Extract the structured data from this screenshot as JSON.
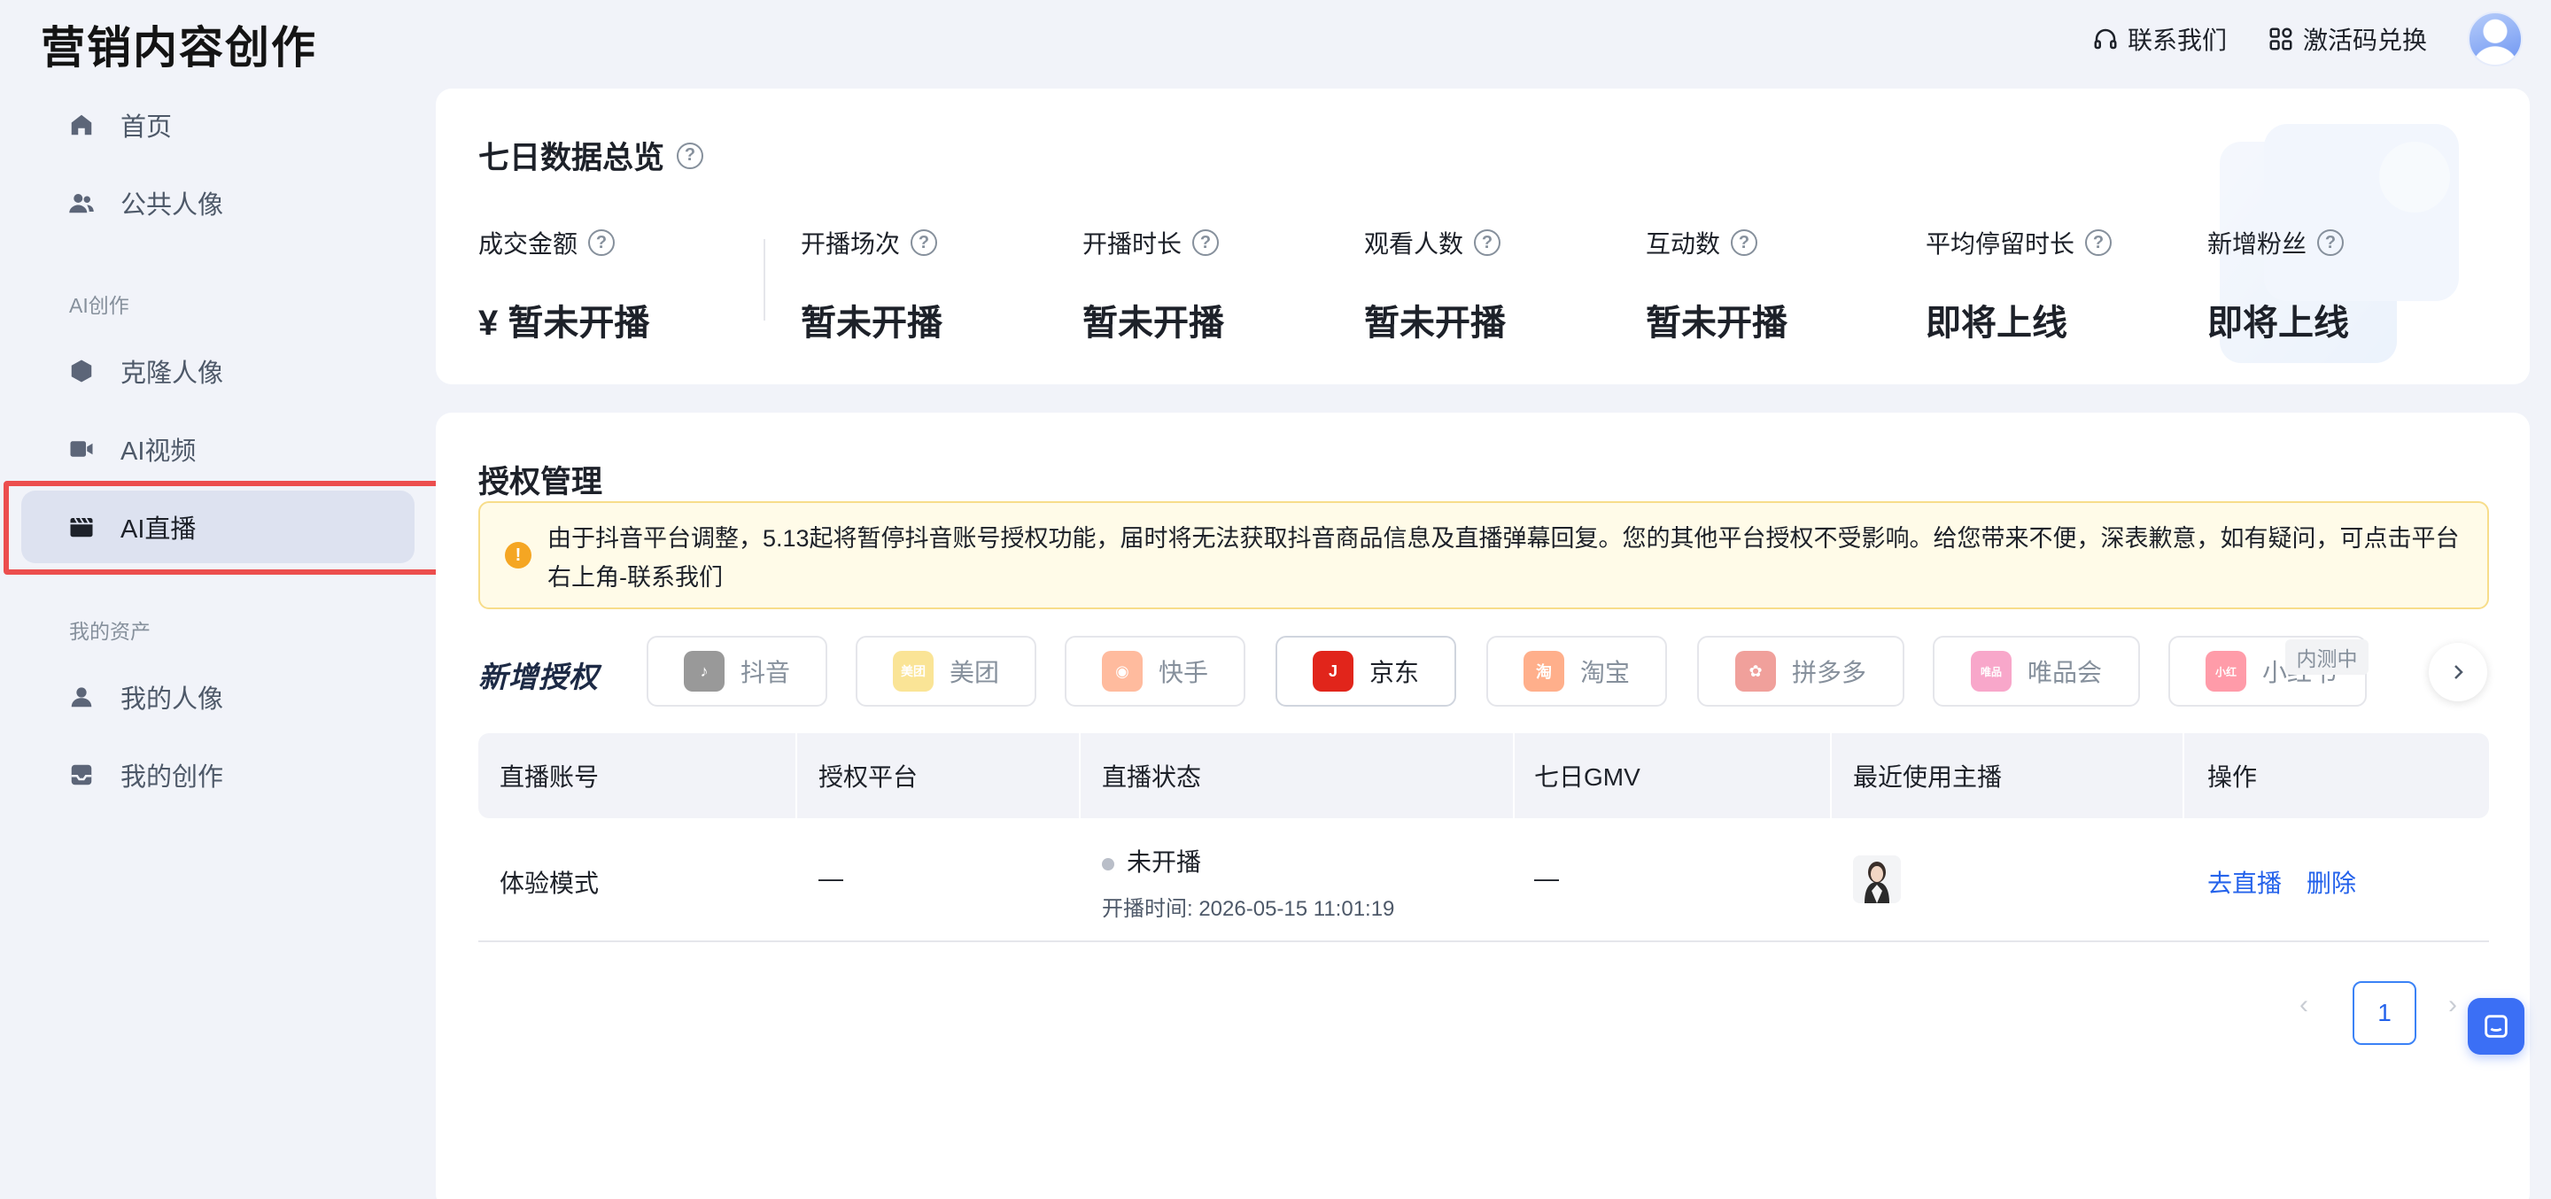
{
  "app": {
    "logo": "营销内容创作"
  },
  "header": {
    "contact": "联系我们",
    "redeem": "激活码兑换"
  },
  "sidebar": {
    "items": [
      {
        "label": "首页",
        "icon": "home-icon"
      },
      {
        "label": "公共人像",
        "icon": "users-icon"
      },
      {
        "label": "克隆人像",
        "icon": "hexagon-icon"
      },
      {
        "label": "AI视频",
        "icon": "video-camera-icon"
      },
      {
        "label": "AI直播",
        "icon": "clapperboard-icon",
        "active": true
      },
      {
        "label": "我的人像",
        "icon": "user-icon"
      },
      {
        "label": "我的创作",
        "icon": "inbox-icon"
      }
    ],
    "groups": {
      "ai_create": "AI创作",
      "my_assets": "我的资产"
    }
  },
  "stats": {
    "title": "七日数据总览",
    "items": [
      {
        "label": "成交金额",
        "value": "¥ 暂未开播"
      },
      {
        "label": "开播场次",
        "value": "暂未开播"
      },
      {
        "label": "开播时长",
        "value": "暂未开播"
      },
      {
        "label": "观看人数",
        "value": "暂未开播"
      },
      {
        "label": "互动数",
        "value": "暂未开播"
      },
      {
        "label": "平均停留时长",
        "value": "即将上线"
      },
      {
        "label": "新增粉丝",
        "value": "即将上线"
      }
    ]
  },
  "auth": {
    "title": "授权管理",
    "notice": "由于抖音平台调整，5.13起将暂停抖音账号授权功能，届时将无法获取抖音商品信息及直播弹幕回复。您的其他平台授权不受影响。给您带来不便，深表歉意，如有疑问，可点击平台右上角-联系我们",
    "new_auth": "新增授权",
    "platforms": [
      {
        "name": "抖音",
        "icon": "douyin-icon",
        "color": "#1f1f1f"
      },
      {
        "name": "美团",
        "icon": "meituan-icon",
        "color": "#f5c518"
      },
      {
        "name": "快手",
        "icon": "kuaishou-icon",
        "color": "#ff6a2b"
      },
      {
        "name": "京东",
        "icon": "jd-icon",
        "color": "#e1251b"
      },
      {
        "name": "淘宝",
        "icon": "taobao-icon",
        "color": "#ff5000"
      },
      {
        "name": "拼多多",
        "icon": "pinduoduo-icon",
        "color": "#e02e24"
      },
      {
        "name": "唯品会",
        "icon": "vipshop-icon",
        "color": "#f03d8c"
      },
      {
        "name": "小红书",
        "icon": "xiaohongshu-icon",
        "color": "#ff2442"
      }
    ],
    "beta_tag": "内测中",
    "table": {
      "headers": [
        "直播账号",
        "授权平台",
        "直播状态",
        "七日GMV",
        "最近使用主播",
        "操作"
      ],
      "rows": [
        {
          "account": "体验模式",
          "platform": "—",
          "status": "未开播",
          "start_time": "开播时间: 2026-05-15 11:01:19",
          "gmv": "—",
          "actions": [
            "去直播",
            "删除"
          ]
        }
      ]
    },
    "pagination": {
      "current": "1",
      "prev": "‹",
      "next": "›"
    }
  }
}
